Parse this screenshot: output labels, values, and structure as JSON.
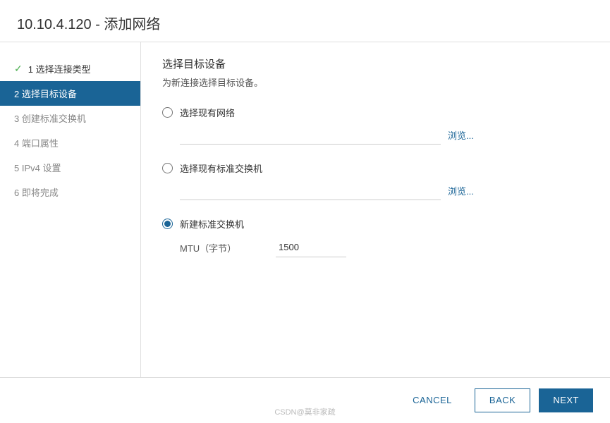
{
  "title_bar": {
    "text": "10.10.4.120 - 添加网络"
  },
  "sidebar": {
    "items": [
      {
        "id": "step1",
        "label": "1 选择连接类型",
        "state": "completed"
      },
      {
        "id": "step2",
        "label": "2 选择目标设备",
        "state": "active"
      },
      {
        "id": "step3",
        "label": "3 创建标准交换机",
        "state": "default"
      },
      {
        "id": "step4",
        "label": "4 端口属性",
        "state": "default"
      },
      {
        "id": "step5",
        "label": "5 IPv4 设置",
        "state": "default"
      },
      {
        "id": "step6",
        "label": "6 即将完成",
        "state": "default"
      }
    ]
  },
  "panel": {
    "title": "选择目标设备",
    "description": "为新连接选择目标设备。",
    "options": [
      {
        "id": "opt1",
        "label": "选择现有网络",
        "selected": false
      },
      {
        "id": "opt2",
        "label": "选择现有标准交换机",
        "selected": false
      },
      {
        "id": "opt3",
        "label": "新建标准交换机",
        "selected": true
      }
    ],
    "browse_label1": "浏览...",
    "browse_label2": "浏览...",
    "mtu_label": "MTU（字节）",
    "mtu_value": "1500"
  },
  "footer": {
    "cancel_label": "CANCEL",
    "back_label": "BACK",
    "next_label": "NEXT"
  },
  "watermark": "CSDN@莫非家疏"
}
